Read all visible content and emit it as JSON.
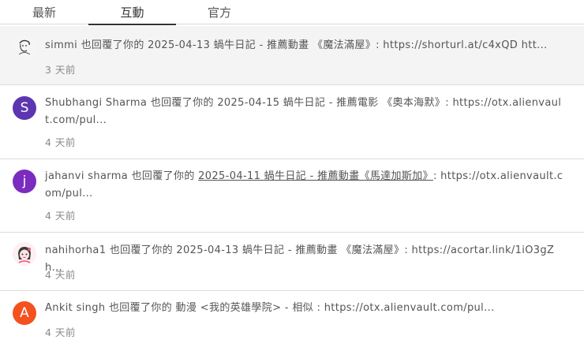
{
  "tabs": [
    {
      "label": "最新"
    },
    {
      "label": "互動"
    },
    {
      "label": "官方"
    }
  ],
  "colors": {
    "active_tab_underline": "#333333",
    "highlight_row": "#f4f4f4",
    "avatar_shubhangi": "#5e35b1",
    "avatar_jahanvi": "#7b2cbf",
    "avatar_ankit": "#f4511e"
  },
  "notifications": [
    {
      "user": "simmi",
      "action": "也回覆了你的",
      "content": "2025-04-13 蝸牛日記 - 推薦動畫 《魔法滿屋》: https://shorturl.at/c4xQD htt...",
      "time": "3 天前",
      "avatar_icon": "sketch-avatar-icon"
    },
    {
      "user": "Shubhangi Sharma",
      "action": "也回覆了你的",
      "content": "2025-04-15 蝸牛日記 - 推薦電影 《奧本海默》: https://otx.alienvault.com/pul...",
      "time": "4 天前",
      "avatar_letter": "S"
    },
    {
      "user": "jahanvi sharma",
      "action": "也回覆了你的",
      "content_link": "2025-04-11 蝸牛日記 - 推薦動畫《馬達加斯加》",
      "content_rest": ": https://otx.alienvault.com/pul...",
      "time": "4 天前",
      "avatar_letter": "j"
    },
    {
      "user": "nahihorha1",
      "action": "也回覆了你的",
      "content": "2025-04-13 蝸牛日記 - 推薦動畫 《魔法滿屋》: https://acortar.link/1iO3gZ h...",
      "time": "4 天前",
      "avatar_icon": "anime-avatar-icon"
    },
    {
      "user": "Ankit singh",
      "action": "也回覆了你的",
      "content": "動漫 <我的英雄學院> - 相似 : https://otx.alienvault.com/pul...",
      "time": "4 天前",
      "avatar_letter": "A"
    }
  ]
}
